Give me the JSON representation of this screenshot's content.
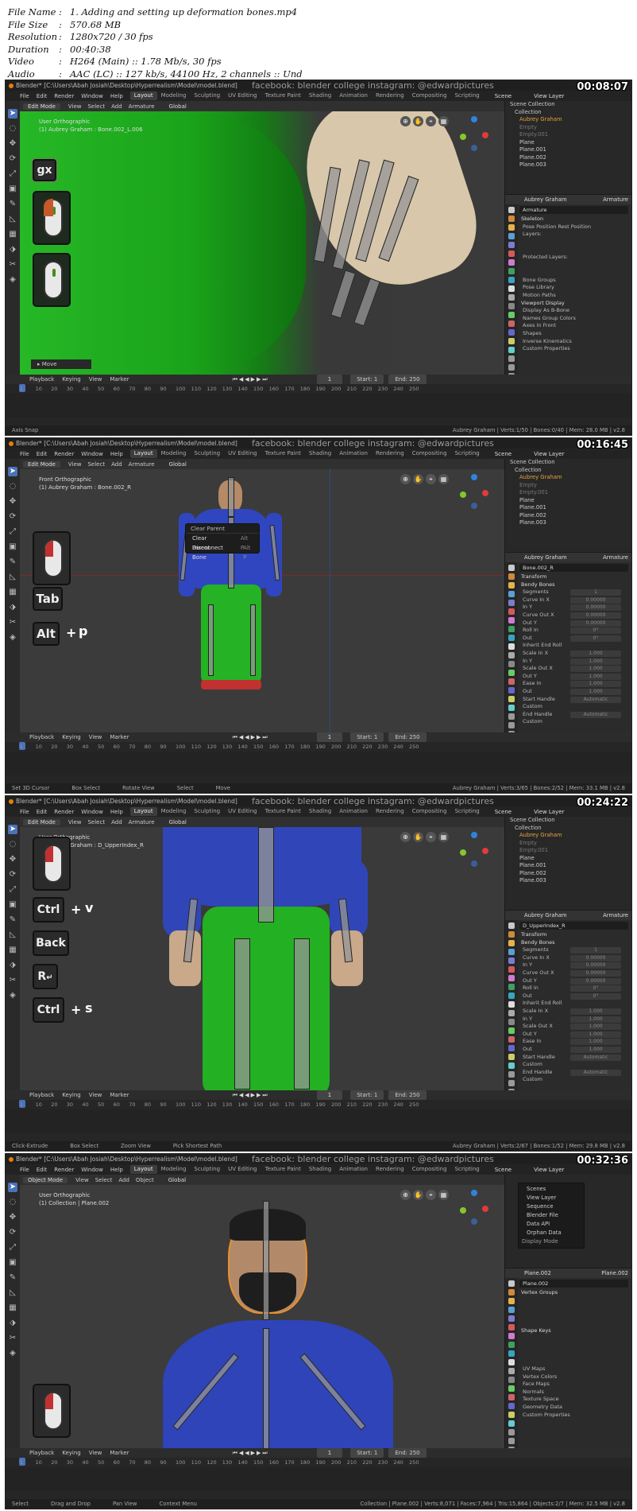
{
  "info": {
    "rows": [
      {
        "key": "File Name",
        "value": "1. Adding and setting up deformation bones.mp4"
      },
      {
        "key": "File Size",
        "value": "570.68 MB"
      },
      {
        "key": "Resolution",
        "value": "1280x720 / 30 fps"
      },
      {
        "key": "Duration",
        "value": "00:40:38"
      },
      {
        "key": "Video",
        "value": "H264 (Main) :: 1.78 Mb/s, 30 fps"
      },
      {
        "key": "Audio",
        "value": "AAC (LC) :: 127 kb/s, 44100 Hz, 2 channels :: Und"
      }
    ]
  },
  "common": {
    "title": "Blender* [C:\\Users\\Abah Josiah\\Desktop\\Hyperrealism\\Model\\model.blend]",
    "watermark": "facebook: blender college   instagram: @edwardpictures",
    "menus": [
      "File",
      "Edit",
      "Render",
      "Window",
      "Help"
    ],
    "tabs": [
      "Layout",
      "Modeling",
      "Sculpting",
      "UV Editing",
      "Texture Paint",
      "Shading",
      "Animation",
      "Rendering",
      "Compositing",
      "Scripting"
    ],
    "scene": "Scene",
    "view_layer": "View Layer",
    "edit_header": [
      "View",
      "Select",
      "Add",
      "Armature"
    ],
    "transform": "Global",
    "timeline": {
      "menus": [
        "Playback",
        "Keying",
        "View",
        "Marker"
      ],
      "frame": "1",
      "start_label": "Start",
      "start": "1",
      "end_label": "End",
      "end": "250"
    },
    "ruler": [
      "1",
      "10",
      "20",
      "30",
      "40",
      "50",
      "60",
      "70",
      "80",
      "90",
      "100",
      "110",
      "120",
      "130",
      "140",
      "150",
      "160",
      "170",
      "180",
      "190",
      "200",
      "210",
      "220",
      "230",
      "240",
      "250"
    ]
  },
  "frames": [
    {
      "timestamp": "00:08:07",
      "mode": "Edit Mode",
      "view": "User Orthographic",
      "context": "(1) Aubrey Graham : Bone.002_L.006",
      "outliner": [
        "Scene Collection",
        "Collection",
        "Aubrey Graham",
        "Empty",
        "Empty.001",
        "Plane",
        "Plane.001",
        "Plane.002",
        "Plane.003"
      ],
      "prop_head": "Aubrey Graham",
      "prop_head2": "Armature",
      "prop_field": "Armature",
      "props": [
        "Skeleton",
        "Pose Position    Rest Position",
        "Layers:",
        "",
        "",
        "Protected Layers:",
        "",
        "",
        "Bone Groups",
        "Pose Library",
        "Motion Paths",
        "Viewport Display",
        "Display As         B-Bone",
        "Names           Group Colors",
        "Axes              In Front",
        "Shapes",
        "Inverse Kinematics",
        "Custom Properties"
      ],
      "keys": [
        "gx"
      ],
      "operator": "Move",
      "status": [
        "Axis Snap"
      ],
      "status_right": "Aubrey Graham | Verts:1/50 | Bones:0/40 | Mem: 28.0 MB | v2.8"
    },
    {
      "timestamp": "00:16:45",
      "mode": "Edit Mode",
      "view": "Front Orthographic",
      "context": "(1) Aubrey Graham : Bone.002_R",
      "outliner": [
        "Scene Collection",
        "Collection",
        "Aubrey Graham",
        "Empty",
        "Empty.001",
        "Plane",
        "Plane.001",
        "Plane.002",
        "Plane.003"
      ],
      "prop_head": "Aubrey Graham",
      "prop_head2": "Armature",
      "prop_field": "Bone.002_R",
      "props": [
        "Transform",
        "Bendy Bones",
        "Segments",
        "Curve In X",
        "In Y",
        "Curve Out X",
        "Out Y",
        "Roll In",
        "Out",
        "Inherit End Roll",
        "Scale In X",
        "In Y",
        "Scale Out X",
        "Out Y",
        "Ease In",
        "Out",
        "Start Handle",
        "Custom",
        "End Handle",
        "Custom"
      ],
      "prop_values": [
        "1",
        "0.00000",
        "0.00000",
        "0.00000",
        "0.00000",
        "0°",
        "0°",
        "",
        "1.000",
        "1.000",
        "1.000",
        "1.000",
        "1.000",
        "1.000",
        "Automatic",
        "",
        "Automatic",
        ""
      ],
      "menu": {
        "header": "Clear Parent",
        "items": [
          {
            "label": "Clear Parent",
            "shortcut": "Alt P"
          },
          {
            "label": "Disconnect Bone",
            "shortcut": "Alt P"
          }
        ]
      },
      "keys": [
        "Tab",
        "Alt",
        "p"
      ],
      "status": [
        "Set 3D Cursor",
        "Box Select",
        "Rotate View",
        "Select",
        "Move"
      ],
      "status_right": "Aubrey Graham | Verts:3/65 | Bones:2/52 | Mem: 33.1 MB | v2.8"
    },
    {
      "timestamp": "00:24:22",
      "mode": "Edit Mode",
      "view": "User Orthographic",
      "context": "(1) Aubrey Graham : D_UpperIndex_R",
      "outliner": [
        "Scene Collection",
        "Collection",
        "Aubrey Graham",
        "Empty",
        "Empty.001",
        "Plane",
        "Plane.001",
        "Plane.002",
        "Plane.003"
      ],
      "prop_head": "Aubrey Graham",
      "prop_head2": "Armature",
      "prop_field": "D_UpperIndex_R",
      "props": [
        "Transform",
        "Bendy Bones",
        "Segments",
        "Curve In X",
        "In Y",
        "Curve Out X",
        "Out Y",
        "Roll In",
        "Out",
        "Inherit End Roll",
        "Scale In X",
        "In Y",
        "Scale Out X",
        "Out Y",
        "Ease In",
        "Out",
        "Start Handle",
        "Custom",
        "End Handle",
        "Custom"
      ],
      "prop_values": [
        "1",
        "0.00000",
        "0.00000",
        "0.00000",
        "0.00000",
        "0°",
        "0°",
        "",
        "1.000",
        "1.000",
        "1.000",
        "1.000",
        "1.000",
        "1.000",
        "Automatic",
        "",
        "Automatic",
        ""
      ],
      "keys": [
        "Ctrl",
        "v",
        "Back",
        "R",
        "↵",
        "Ctrl",
        "s"
      ],
      "status": [
        "Click-Extrude",
        "Box Select",
        "Zoom View",
        "Pick Shortest Path"
      ],
      "status_right": "Aubrey Graham | Verts:2/67 | Bones:1/52 | Mem: 29.8 MB | v2.8"
    },
    {
      "timestamp": "00:32:36",
      "mode": "Object Mode",
      "view": "User Orthographic",
      "context": "(1) Collection | Plane.002",
      "dropdown": [
        "Scenes",
        "View Layer",
        "Sequence",
        "Blender File",
        "Data API",
        "Orphan Data",
        "Display Mode"
      ],
      "prop_head": "Plane.002",
      "prop_head2": "Plane.002",
      "prop_field": "Plane.002",
      "props": [
        "Vertex Groups",
        "",
        "",
        "",
        "",
        "Shape Keys",
        "",
        "",
        "",
        "",
        "UV Maps",
        "Vertex Colors",
        "Face Maps",
        "Normals",
        "Texture Space",
        "Geometry Data",
        "Custom Properties"
      ],
      "status": [
        "Select",
        "Drag and Drop",
        "Pan View",
        "Context Menu"
      ],
      "status_right": "Collection | Plane.002 | Verts:8,071 | Faces:7,964 | Tris:15,864 | Objects:2/7 | Mem: 32.5 MB | v2.8"
    }
  ]
}
